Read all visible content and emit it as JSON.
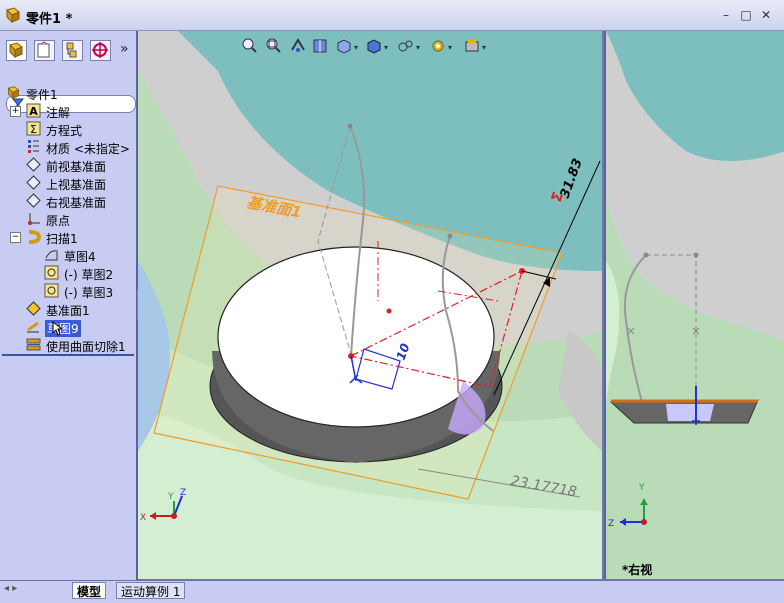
{
  "window": {
    "title": "零件1 *"
  },
  "feature_tree": {
    "root": "零件1",
    "items": [
      {
        "label": "注解",
        "icon": "annotation-icon"
      },
      {
        "label": "方程式",
        "icon": "equation-icon"
      },
      {
        "label": "材质 <未指定>",
        "icon": "material-icon"
      },
      {
        "label": "前视基准面",
        "icon": "plane-icon"
      },
      {
        "label": "上视基准面",
        "icon": "plane-icon"
      },
      {
        "label": "右视基准面",
        "icon": "plane-icon"
      },
      {
        "label": "原点",
        "icon": "origin-icon"
      },
      {
        "label": "扫描1",
        "icon": "sweep-icon"
      },
      {
        "label": "草图4",
        "icon": "sketch-icon"
      },
      {
        "label": "(-) 草图2",
        "icon": "sketch-icon"
      },
      {
        "label": "(-) 草图3",
        "icon": "sketch-icon"
      },
      {
        "label": "基准面1",
        "icon": "plane-icon"
      },
      {
        "label": "草图9",
        "icon": "sketch-icon"
      },
      {
        "label": "使用曲面切除1",
        "icon": "surface-cut-icon"
      }
    ]
  },
  "viewport": {
    "plane_label": "基准面1",
    "dimension_vertical": "31.83",
    "dimension_horizontal": "23.17718",
    "small_dim": "10",
    "axis_labels": {
      "x": "X",
      "y": "Y",
      "z": "Z"
    }
  },
  "right_view": {
    "label": "*右视",
    "axis_labels": {
      "y": "Y",
      "z": "Z"
    }
  },
  "tabs": {
    "model": "模型",
    "motion": "运动算例 1"
  },
  "colors": {
    "accent": "#3354a8",
    "selection": "#3b5bd6",
    "plane": "#f39b2a",
    "dimension_red": "#e02020"
  }
}
